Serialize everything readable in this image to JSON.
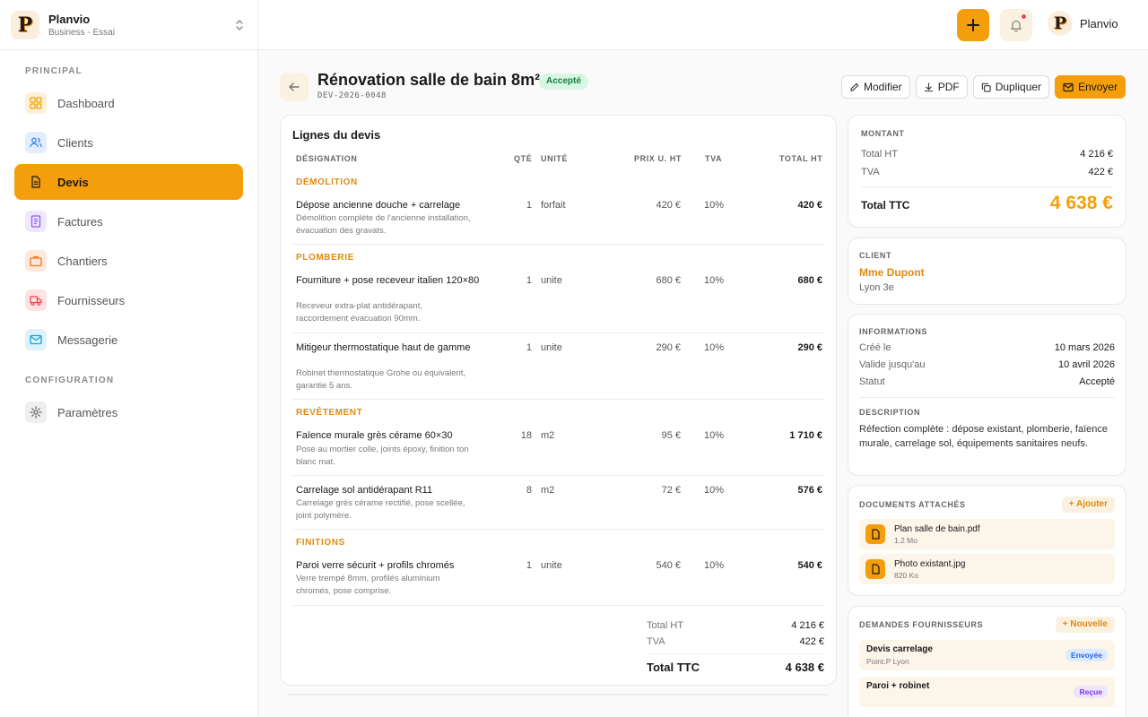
{
  "brand": {
    "name": "Planvio",
    "plan": "Business - Essai",
    "logo_letter": "P"
  },
  "sidebar": {
    "section_principal": "PRINCIPAL",
    "section_config": "CONFIGURATION",
    "items": [
      {
        "label": "Dashboard",
        "icon": "dashboard-icon",
        "color": "#f59e0b",
        "bg": "#fdf0d8"
      },
      {
        "label": "Clients",
        "icon": "users-icon",
        "color": "#3b82f6",
        "bg": "#e2edfd"
      },
      {
        "label": "Devis",
        "icon": "document-icon",
        "color": "#1a1a1a",
        "bg": "#f59e0b",
        "active": true
      },
      {
        "label": "Factures",
        "icon": "invoice-icon",
        "color": "#8b5cf6",
        "bg": "#efe7fd"
      },
      {
        "label": "Chantiers",
        "icon": "briefcase-icon",
        "color": "#f97316",
        "bg": "#fde9dc"
      },
      {
        "label": "Fournisseurs",
        "icon": "truck-icon",
        "color": "#ef4444",
        "bg": "#fde2e2"
      },
      {
        "label": "Messagerie",
        "icon": "mail-icon",
        "color": "#0ea5e9",
        "bg": "#dff2fb"
      }
    ],
    "config_items": [
      {
        "label": "Paramètres",
        "icon": "gear-icon",
        "color": "#666",
        "bg": "#efefef"
      }
    ]
  },
  "topbar": {
    "user_name": "Planvio"
  },
  "header": {
    "title": "Rénovation salle de bain 8m²",
    "status": "Accepté",
    "reference": "DEV-2026-0048",
    "actions": {
      "edit": "Modifier",
      "pdf": "PDF",
      "duplicate": "Dupliquer",
      "send": "Envoyer"
    }
  },
  "lines": {
    "title": "Lignes du devis",
    "columns": {
      "designation": "DÉSIGNATION",
      "qty": "QTÉ",
      "unit": "UNITÉ",
      "price": "PRIX U. HT",
      "vat": "TVA",
      "total": "TOTAL HT"
    },
    "sections": [
      {
        "title": "DÉMOLITION"
      },
      {
        "title": "PLOMBERIE"
      },
      {
        "title": "REVÊTEMENT"
      },
      {
        "title": "FINITIONS"
      }
    ],
    "rows": [
      {
        "title": "Dépose ancienne douche + carrelage",
        "desc": "Démolition complète de l'ancienne installation, évacuation des gravats.",
        "qty": "1",
        "unit": "forfait",
        "price": "420 €",
        "vat": "10%",
        "total": "420 €"
      },
      {
        "title": "Fourniture + pose receveur italien 120×80",
        "desc": "Receveur extra-plat antidérapant, raccordement évacuation 90mm.",
        "qty": "1",
        "unit": "unite",
        "price": "680 €",
        "vat": "10%",
        "total": "680 €"
      },
      {
        "title": "Mitigeur thermostatique haut de gamme",
        "desc": "Robinet thermostatique Grohe ou équivalent, garantie 5 ans.",
        "qty": "1",
        "unit": "unite",
        "price": "290 €",
        "vat": "10%",
        "total": "290 €"
      },
      {
        "title": "Faïence murale grès cérame 60×30",
        "desc": "Pose au mortier colle, joints époxy, finition ton blanc mat.",
        "qty": "18",
        "unit": "m2",
        "price": "95 €",
        "vat": "10%",
        "total": "1 710 €"
      },
      {
        "title": "Carrelage sol antidérapant R11",
        "desc": "Carrelage grès cérame rectifié, pose scellée, joint polymère.",
        "qty": "8",
        "unit": "m2",
        "price": "72 €",
        "vat": "10%",
        "total": "576 €"
      },
      {
        "title": "Paroi verre sécurit + profils chromés",
        "desc": "Verre trempé 8mm, profilés aluminium chromés, pose comprise.",
        "qty": "1",
        "unit": "unite",
        "price": "540 €",
        "vat": "10%",
        "total": "540 €"
      }
    ],
    "summary": {
      "ht_label": "Total HT",
      "ht": "4 216 €",
      "tva_label": "TVA",
      "tva": "422 €",
      "ttc_label": "Total TTC",
      "ttc": "4 638 €"
    }
  },
  "amount": {
    "label": "MONTANT",
    "ht_label": "Total HT",
    "ht": "4 216 €",
    "tva_label": "TVA",
    "tva": "422 €",
    "ttc_label": "Total TTC",
    "ttc": "4 638 €"
  },
  "client": {
    "label": "CLIENT",
    "name": "Mme Dupont",
    "city": "Lyon 3e"
  },
  "info": {
    "label": "INFORMATIONS",
    "created_label": "Créé le",
    "created": "10 mars 2026",
    "valid_label": "Valide jusqu'au",
    "valid": "10 avril 2026",
    "status_label": "Statut",
    "status": "Accepté",
    "desc_label": "DESCRIPTION",
    "desc": "Réfection complète : dépose existant, plomberie, faïence murale, carrelage sol, équipements sanitaires neufs."
  },
  "documents": {
    "label": "DOCUMENTS ATTACHÉS",
    "add": "+ Ajouter",
    "items": [
      {
        "name": "Plan salle de bain.pdf",
        "size": "1.2 Mo"
      },
      {
        "name": "Photo existant.jpg",
        "size": "820 Ko"
      }
    ]
  },
  "requests": {
    "label": "DEMANDES FOURNISSEURS",
    "add": "+ Nouvelle",
    "items": [
      {
        "name": "Devis carrelage",
        "sub": "Point.P Lyon",
        "status": "Envoyée"
      },
      {
        "name": "Paroi + robinet",
        "sub": "",
        "status": "Reçue"
      }
    ]
  },
  "colors": {
    "accent": "#f59e0b",
    "accent_text": "#e08a10",
    "success_bg": "#d9f5e3",
    "success_text": "#15803d"
  }
}
